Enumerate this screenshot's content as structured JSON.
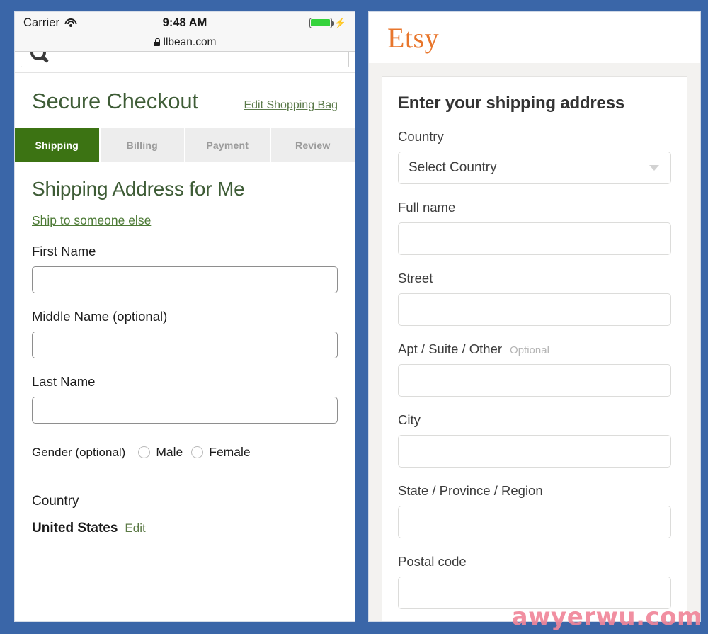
{
  "background_color": "#3a66a8",
  "phone": {
    "status_bar": {
      "carrier": "Carrier",
      "time": "9:48 AM",
      "wifi_icon": "wifi-icon",
      "battery_icon": "battery-icon",
      "charging_icon": "⚡",
      "battery_color": "#35d33c"
    },
    "url_bar": {
      "lock_icon": "lock-icon",
      "url": "llbean.com"
    },
    "search_strip": {
      "search_icon": "search-icon"
    },
    "header": {
      "title": "Secure Checkout",
      "edit_bag_label": "Edit Shopping Bag",
      "title_color": "#3e5c36"
    },
    "tabs": [
      {
        "label": "Shipping",
        "active": true
      },
      {
        "label": "Billing",
        "active": false
      },
      {
        "label": "Payment",
        "active": false
      },
      {
        "label": "Review",
        "active": false
      }
    ],
    "active_tab_color": "#3c7313",
    "section_title": "Shipping Address for Me",
    "ship_to_someone_else": "Ship to someone else",
    "fields": [
      {
        "label": "First Name",
        "value": ""
      },
      {
        "label": "Middle Name (optional)",
        "value": ""
      },
      {
        "label": "Last Name",
        "value": ""
      }
    ],
    "gender": {
      "label": "Gender (optional)",
      "options": [
        {
          "label": "Male",
          "selected": false
        },
        {
          "label": "Female",
          "selected": false
        }
      ]
    },
    "country": {
      "label": "Country",
      "value": "United States",
      "edit_label": "Edit"
    }
  },
  "etsy": {
    "logo": "Etsy",
    "logo_color": "#e8762c",
    "card_title": "Enter your shipping address",
    "country": {
      "label": "Country",
      "selected": "Select Country",
      "chevron_icon": "chevron-down-icon"
    },
    "fields": [
      {
        "label": "Full name",
        "optional": "",
        "value": ""
      },
      {
        "label": "Street",
        "optional": "",
        "value": ""
      },
      {
        "label": "Apt / Suite / Other",
        "optional": "Optional",
        "value": ""
      },
      {
        "label": "City",
        "optional": "",
        "value": ""
      },
      {
        "label": "State / Province / Region",
        "optional": "",
        "value": ""
      },
      {
        "label": "Postal code",
        "optional": "",
        "value": ""
      }
    ]
  },
  "watermark": {
    "text": "awyerwu.com",
    "color": "#f0869a"
  }
}
